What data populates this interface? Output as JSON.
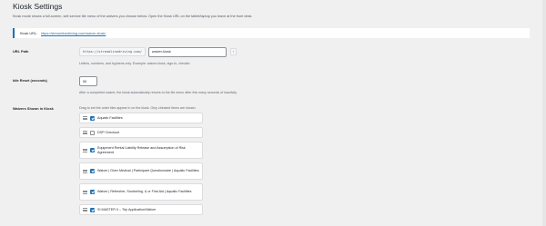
{
  "page": {
    "title": "Kiosk Settings"
  },
  "intro": "Kiosk mode shows a full-screen, self-service tile menu of the waivers you choose below. Open the Kiosk URL on the tablet/laptop you leave at the front desk.",
  "kiosk_url": {
    "label": "Kiosk URL:",
    "link": "https://streamlinedriving.com/waiver-kiosk/"
  },
  "url_path": {
    "label": "URL Path",
    "prefix": "https://streamlinedriving.com/",
    "value": "waiver-kiosk",
    "tail": "/",
    "help": "Letters, numbers, and hyphens only. Example: waiver-kiosk, sign-in, checkin."
  },
  "idle_reset": {
    "label": "Idle Reset (seconds)",
    "value": "90",
    "help": "After a completed waiver, the kiosk automatically returns to the tile menu after this many seconds of inactivity."
  },
  "waivers": {
    "label": "Waivers Shown in Kiosk",
    "help": "Drag to set the order tiles appear in on the kiosk. Only checked items are shown.",
    "items": [
      {
        "label": "Aquatic Facilities",
        "checked": true
      },
      {
        "label": "DSP Checkout",
        "checked": false
      },
      {
        "label": "Equipment Rental Liability Release and Assumption of Risk Agreement",
        "checked": true
      },
      {
        "label": "Waiver | Diver Medical | Participant Questionnaire | Aquatic Facilities",
        "checked": true
      },
      {
        "label": "Waiver | Refresher, Snorkeling, & or First Aid | Aquatic Facilities",
        "checked": true
      },
      {
        "label": "SI MASTER II – Trip Application/Waiver",
        "checked": true
      }
    ]
  },
  "colors": {
    "accent": "#2271b1",
    "background": "#f0f0f1"
  }
}
